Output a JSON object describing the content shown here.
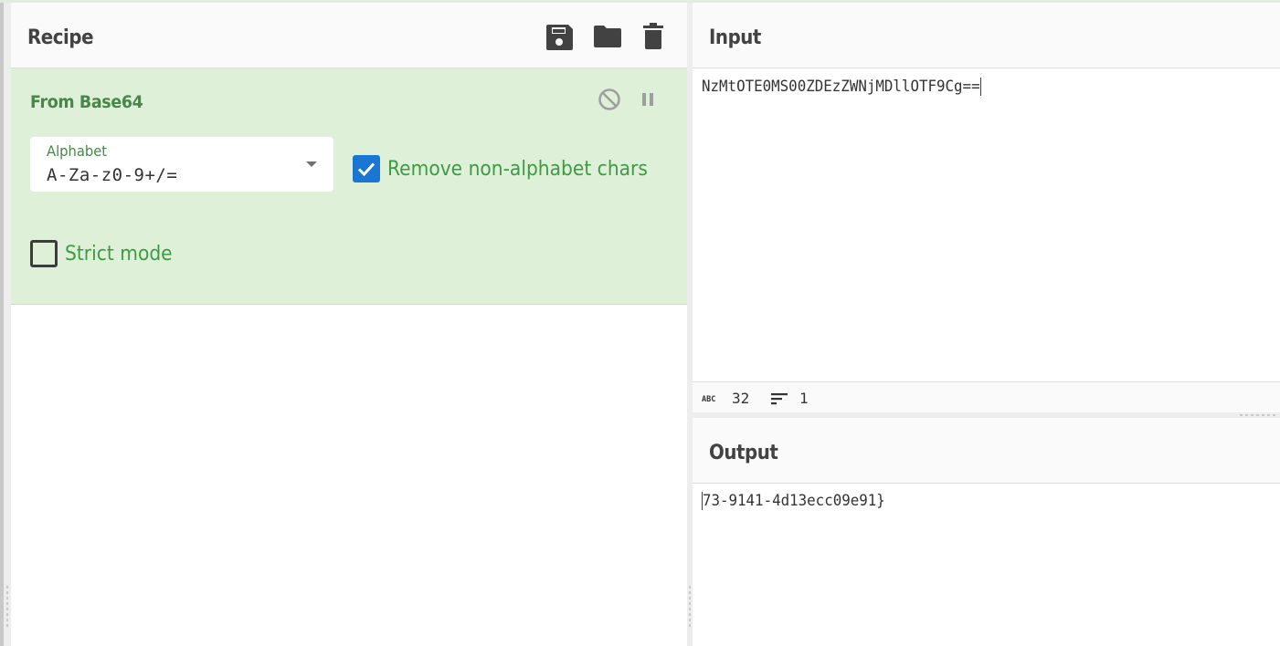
{
  "recipe": {
    "title": "Recipe",
    "actions": [
      {
        "name": "save-recipe",
        "icon": "save-icon"
      },
      {
        "name": "load-recipe",
        "icon": "folder-icon"
      },
      {
        "name": "clear-recipe",
        "icon": "trash-icon"
      }
    ],
    "operations": [
      {
        "title": "From Base64",
        "controls": {
          "disable_icon": "disable-icon",
          "breakpoint_icon": "pause-icon"
        },
        "alphabet": {
          "label": "Alphabet",
          "value": "A-Za-z0-9+/="
        },
        "remove_non_alphabet": {
          "label": "Remove non-alphabet chars",
          "checked": true
        },
        "strict_mode": {
          "label": "Strict mode",
          "checked": false
        }
      }
    ]
  },
  "input": {
    "title": "Input",
    "value": "NzMtOTE0MS00ZDEzZWNjMDllOTF9Cg==",
    "stats": {
      "length_icon": "abc-icon",
      "length": "32",
      "lines_icon": "lines-icon",
      "lines": "1"
    }
  },
  "output": {
    "title": "Output",
    "value": "73-9141-4d13ecc09e91}"
  },
  "colors": {
    "op_background": "#dff0d8",
    "op_text": "#468847",
    "checkbox_checked": "#1976d2"
  }
}
